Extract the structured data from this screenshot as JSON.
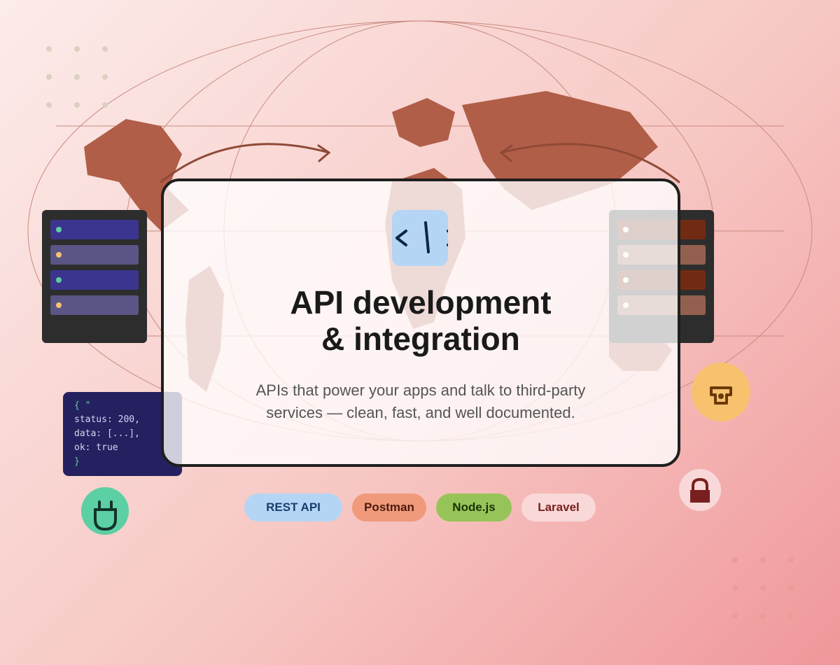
{
  "hero": {
    "title_line1": "API development",
    "title_line2": "& integration",
    "desc_line1": "APIs that power your apps and talk to third-party",
    "desc_line2": "services — clean, fast, and well documented."
  },
  "code_snippet": {
    "lines": [
      "{ \"",
      "status: 200,",
      "data: [...],",
      "ok: true",
      "}"
    ]
  },
  "chips": [
    {
      "label": "REST API",
      "bg": "#b5d5f4",
      "color": "#173e6e"
    },
    {
      "label": "Postman",
      "bg": "#f0997b",
      "color": "#4a1b0c"
    },
    {
      "label": "Node.js",
      "bg": "#97c459",
      "color": "#173404"
    },
    {
      "label": "Laravel",
      "bg": "#f9d8d8",
      "color": "#791f1f"
    }
  ],
  "icons": {
    "code": "code-icon",
    "plug": "plug-icon",
    "printer": "printer-icon",
    "lock": "lock-icon"
  },
  "colors": {
    "map": "#b05e48",
    "server": "#2d2d2d",
    "code_bg": "#252060",
    "accent_green": "#5ccfa4",
    "accent_yellow": "#f8c16e"
  }
}
